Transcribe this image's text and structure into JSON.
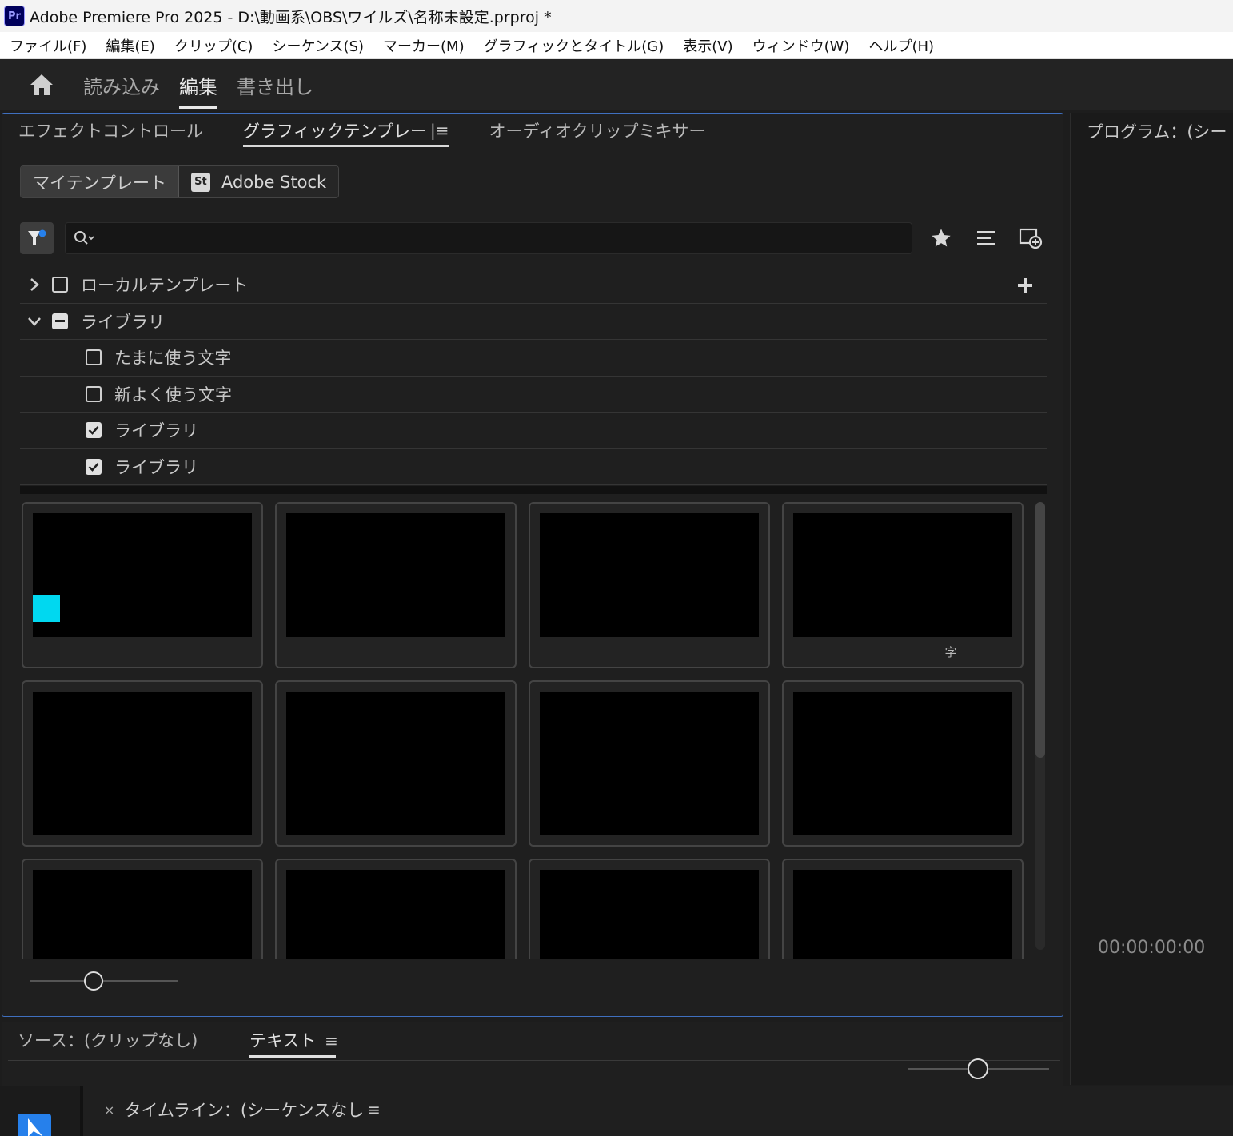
{
  "window": {
    "app_icon_text": "Pr",
    "title": "Adobe Premiere Pro 2025 - D:\\動画系\\OBS\\ワイルズ\\名称未設定.prproj *"
  },
  "menu": {
    "items": [
      "ファイル(F)",
      "編集(E)",
      "クリップ(C)",
      "シーケンス(S)",
      "マーカー(M)",
      "グラフィックとタイトル(G)",
      "表示(V)",
      "ウィンドウ(W)",
      "ヘルプ(H)"
    ]
  },
  "workspace": {
    "tabs": [
      {
        "label": "読み込み",
        "active": false
      },
      {
        "label": "編集",
        "active": true
      },
      {
        "label": "書き出し",
        "active": false
      }
    ]
  },
  "panel": {
    "tabs": [
      {
        "label": "エフェクトコントロール",
        "active": false
      },
      {
        "label": "グラフィックテンプレー",
        "active": true
      },
      {
        "label": "オーディオクリップミキサー",
        "active": false
      }
    ],
    "segments": {
      "my_templates": "マイテンプレート",
      "adobe_stock_icon": "St",
      "adobe_stock": "Adobe Stock"
    },
    "search": {
      "value": "",
      "placeholder": ""
    },
    "tree": {
      "local": "ローカルテンプレート",
      "library": "ライブラリ",
      "children": [
        {
          "label": "たまに使う文字",
          "checked": false
        },
        {
          "label": "新よく使う文字",
          "checked": false
        },
        {
          "label": "ライブラリ",
          "checked": true
        },
        {
          "label": "ライブラリ",
          "checked": true
        }
      ]
    },
    "thumbnail_partial_label": "字"
  },
  "program": {
    "title": "プログラム：(シー",
    "timecode": "00:00:00:00"
  },
  "source": {
    "tab1": "ソース：(クリップなし)",
    "tab2": "テキスト"
  },
  "timeline": {
    "close": "×",
    "title": "タイムライン：(シーケンスなし"
  },
  "colors": {
    "accent_blue": "#2680eb",
    "panel_border": "#3f6fbf",
    "app_icon_bg": "#00005b",
    "app_icon_fg": "#9999ff"
  }
}
